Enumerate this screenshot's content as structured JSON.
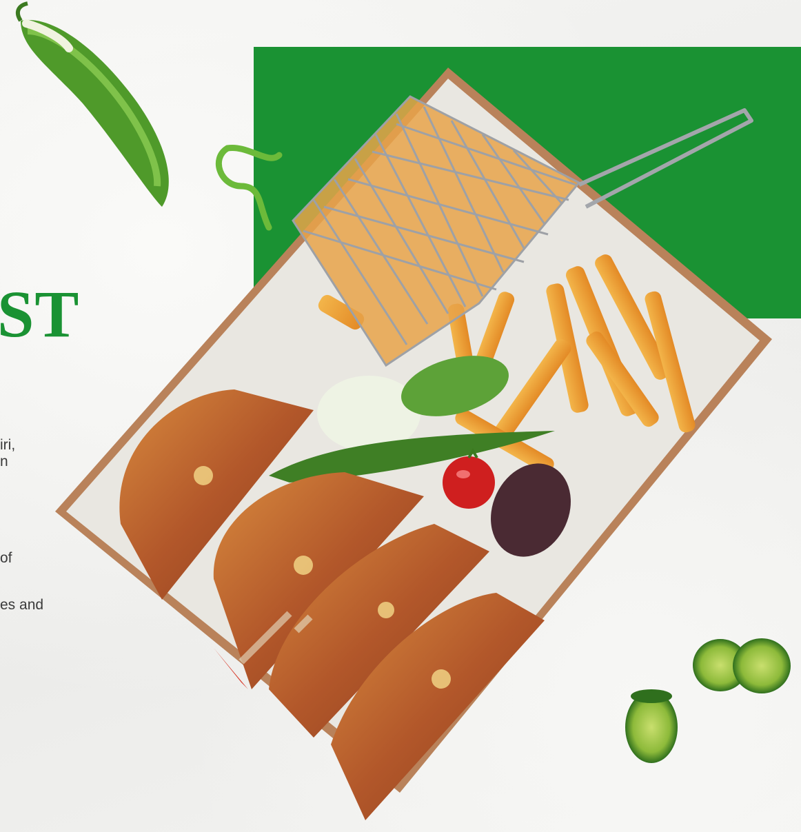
{
  "headline": {
    "text": "ST",
    "color": "#1a9233"
  },
  "description": {
    "line1": "iri,",
    "line2": "n",
    "line3": "of",
    "line4": "es and"
  },
  "colors": {
    "brand_green": "#1a9233",
    "background": "#f1f1ef",
    "text": "#3a3a3a"
  },
  "icons": [
    "green-pepper-icon",
    "cucumber-slice-icon"
  ]
}
